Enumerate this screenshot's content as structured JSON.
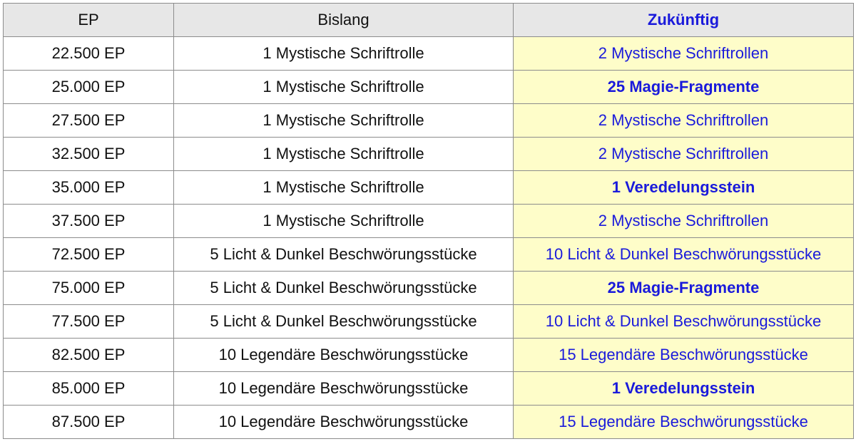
{
  "table": {
    "headers": {
      "ep": "EP",
      "current": "Bislang",
      "future": "Zukünftig"
    },
    "colors": {
      "header_bg": "#e7e7e7",
      "future_bg": "#fefdc9",
      "future_text": "#1a1adb",
      "border": "#8c8c8c"
    },
    "rows": [
      {
        "ep": "22.500 EP",
        "current": "1 Mystische Schriftrolle",
        "future": "2 Mystische Schriftrollen",
        "future_bold": false
      },
      {
        "ep": "25.000 EP",
        "current": "1 Mystische Schriftrolle",
        "future": "25 Magie-Fragmente",
        "future_bold": true
      },
      {
        "ep": "27.500 EP",
        "current": "1 Mystische Schriftrolle",
        "future": "2 Mystische Schriftrollen",
        "future_bold": false
      },
      {
        "ep": "32.500 EP",
        "current": "1 Mystische Schriftrolle",
        "future": "2 Mystische Schriftrollen",
        "future_bold": false
      },
      {
        "ep": "35.000 EP",
        "current": "1 Mystische Schriftrolle",
        "future": "1 Veredelungsstein",
        "future_bold": true
      },
      {
        "ep": "37.500 EP",
        "current": "1 Mystische Schriftrolle",
        "future": "2 Mystische Schriftrollen",
        "future_bold": false
      },
      {
        "ep": "72.500 EP",
        "current": "5 Licht & Dunkel Beschwörungsstücke",
        "future": "10 Licht & Dunkel Beschwörungsstücke",
        "future_bold": false
      },
      {
        "ep": "75.000 EP",
        "current": "5 Licht & Dunkel Beschwörungsstücke",
        "future": "25 Magie-Fragmente",
        "future_bold": true
      },
      {
        "ep": "77.500 EP",
        "current": "5 Licht & Dunkel Beschwörungsstücke",
        "future": "10 Licht & Dunkel Beschwörungsstücke",
        "future_bold": false
      },
      {
        "ep": "82.500 EP",
        "current": "10 Legendäre Beschwörungsstücke",
        "future": "15 Legendäre Beschwörungsstücke",
        "future_bold": false
      },
      {
        "ep": "85.000 EP",
        "current": "10 Legendäre Beschwörungsstücke",
        "future": "1 Veredelungsstein",
        "future_bold": true
      },
      {
        "ep": "87.500 EP",
        "current": "10 Legendäre Beschwörungsstücke",
        "future": "15 Legendäre Beschwörungsstücke",
        "future_bold": false
      }
    ]
  }
}
